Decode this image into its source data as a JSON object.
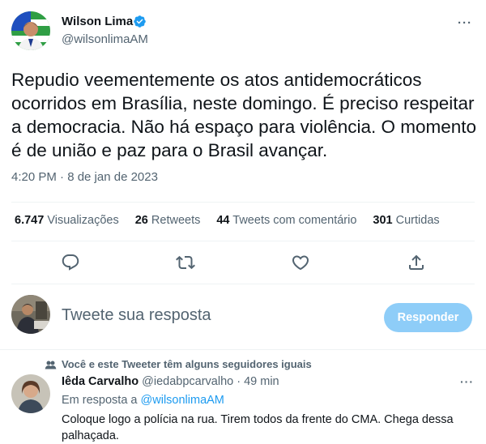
{
  "tweet": {
    "author_name": "Wilson Lima",
    "author_handle": "@wilsonlimaAM",
    "more_label": "···",
    "text": "Repudio veementemente os atos antidemocráticos ocorridos em Brasília, neste domingo. É preciso respeitar a democracia. Não há espaço para violência. O momento é de união e paz para o Brasil avançar.",
    "timestamp": "4:20 PM · 8 de jan de 2023"
  },
  "stats": {
    "views_count": "6.747",
    "views_label": "Visualizações",
    "retweets_count": "26",
    "retweets_label": "Retweets",
    "quotes_count": "44",
    "quotes_label": "Tweets com comentário",
    "likes_count": "301",
    "likes_label": "Curtidas"
  },
  "actions": {
    "reply_icon": "reply-icon",
    "retweet_icon": "retweet-icon",
    "like_icon": "heart-icon",
    "share_icon": "share-icon"
  },
  "compose": {
    "placeholder": "Tweete sua resposta",
    "button_label": "Responder"
  },
  "reply": {
    "social_context": "Você e este Tweeter têm alguns seguidores iguais",
    "author_name": "Iêda Carvalho",
    "author_handle": "@iedabpcarvalho",
    "time": "· 49 min",
    "more_label": "···",
    "replying_to_label": "Em resposta a",
    "replying_to_handle": "@wilsonlimaAM",
    "text": "Coloque logo a polícia na rua. Tirem todos da frente do CMA. Chega dessa palhaçada."
  },
  "colors": {
    "accent": "#1d9bf0",
    "button_disabled": "#8ecdf8",
    "secondary_text": "#536471"
  }
}
